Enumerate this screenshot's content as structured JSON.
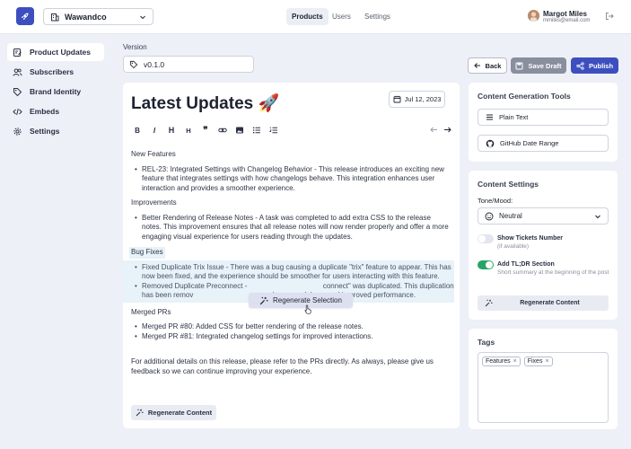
{
  "header": {
    "workspace": "Wawandco",
    "nav": [
      {
        "label": "Products",
        "active": true
      },
      {
        "label": "Users",
        "active": false
      },
      {
        "label": "Settings",
        "active": false
      }
    ],
    "user": {
      "name": "Margot Miles",
      "email": "mmiles@email.com"
    }
  },
  "sidebar": {
    "items": [
      {
        "label": "Product Updates",
        "icon": "document-edit-icon",
        "active": true
      },
      {
        "label": "Subscribers",
        "icon": "users-icon",
        "active": false
      },
      {
        "label": "Brand Identity",
        "icon": "tag-icon",
        "active": false
      },
      {
        "label": "Embeds",
        "icon": "code-icon",
        "active": false
      },
      {
        "label": "Settings",
        "icon": "gear-icon",
        "active": false
      }
    ]
  },
  "version": {
    "label": "Version",
    "value": "v0.1.0"
  },
  "actions": {
    "back": "Back",
    "save_draft": "Save Draft",
    "publish": "Publish"
  },
  "editor": {
    "title": "Latest Updates 🚀",
    "date": "Jul 12, 2023",
    "toolbar": [
      "B",
      "I",
      "H",
      "H",
      "❞",
      "link",
      "image",
      "bullet-list",
      "numbered-list"
    ],
    "sections": {
      "new_features": {
        "heading": "New Features",
        "items": [
          "REL-23: Integrated Settings with Changelog Behavior - This release introduces an exciting new feature that integrates settings with how changelogs behave. This integration enhances user interaction and provides a smoother experience."
        ]
      },
      "improvements": {
        "heading": "Improvements",
        "items": [
          "Better Rendering of Release Notes - A task was completed to add extra CSS to the release notes. This improvement ensures that all release notes will now render properly and offer a more engaging visual experience for users reading through the updates."
        ]
      },
      "bug_fixes": {
        "heading": "Bug Fixes",
        "items": [
          "Fixed Duplicate Trix Issue - There was a bug causing a duplicate \"trix\" feature to appear. This has now been fixed, and the experience should be smoother for users interacting with this feature.",
          "Removed Duplicate Preconnect -                                      connect\" was duplicated. This duplication has been remov                                g a cleaner codebase and improved performance."
        ]
      },
      "merged_prs": {
        "heading": "Merged PRs",
        "items": [
          "Merged PR #80: Added CSS for better rendering of the release notes.",
          "Merged PR #81: Integrated changelog settings for improved interactions."
        ]
      }
    },
    "footer_text": "For additional details on this release, please refer to the PRs directly. As always, please give us feedback so we can continue improving your experience.",
    "regen_selection": "Regenerate Selection",
    "regen_content": "Regenerate Content"
  },
  "tools_card": {
    "title": "Content Generation Tools",
    "plain_text": "Plain Text",
    "github_range": "GitHub Date Range"
  },
  "settings_card": {
    "title": "Content Settings",
    "tone_label": "Tone/Mood:",
    "tone_value": "Neutral",
    "show_tickets": {
      "label": "Show Tickets Number",
      "hint": "(if available)",
      "on": false
    },
    "tldr": {
      "label": "Add TL;DR Section",
      "hint": "Short summary at the beginning of the post",
      "on": true
    },
    "regen": "Regenerate Content"
  },
  "tags_card": {
    "title": "Tags",
    "tags": [
      "Features",
      "Fixes"
    ],
    "remove_glyph": "×"
  },
  "colors": {
    "accent": "#3d4fbf",
    "toggle_on": "#27a566",
    "highlight": "#e7f2f9"
  }
}
